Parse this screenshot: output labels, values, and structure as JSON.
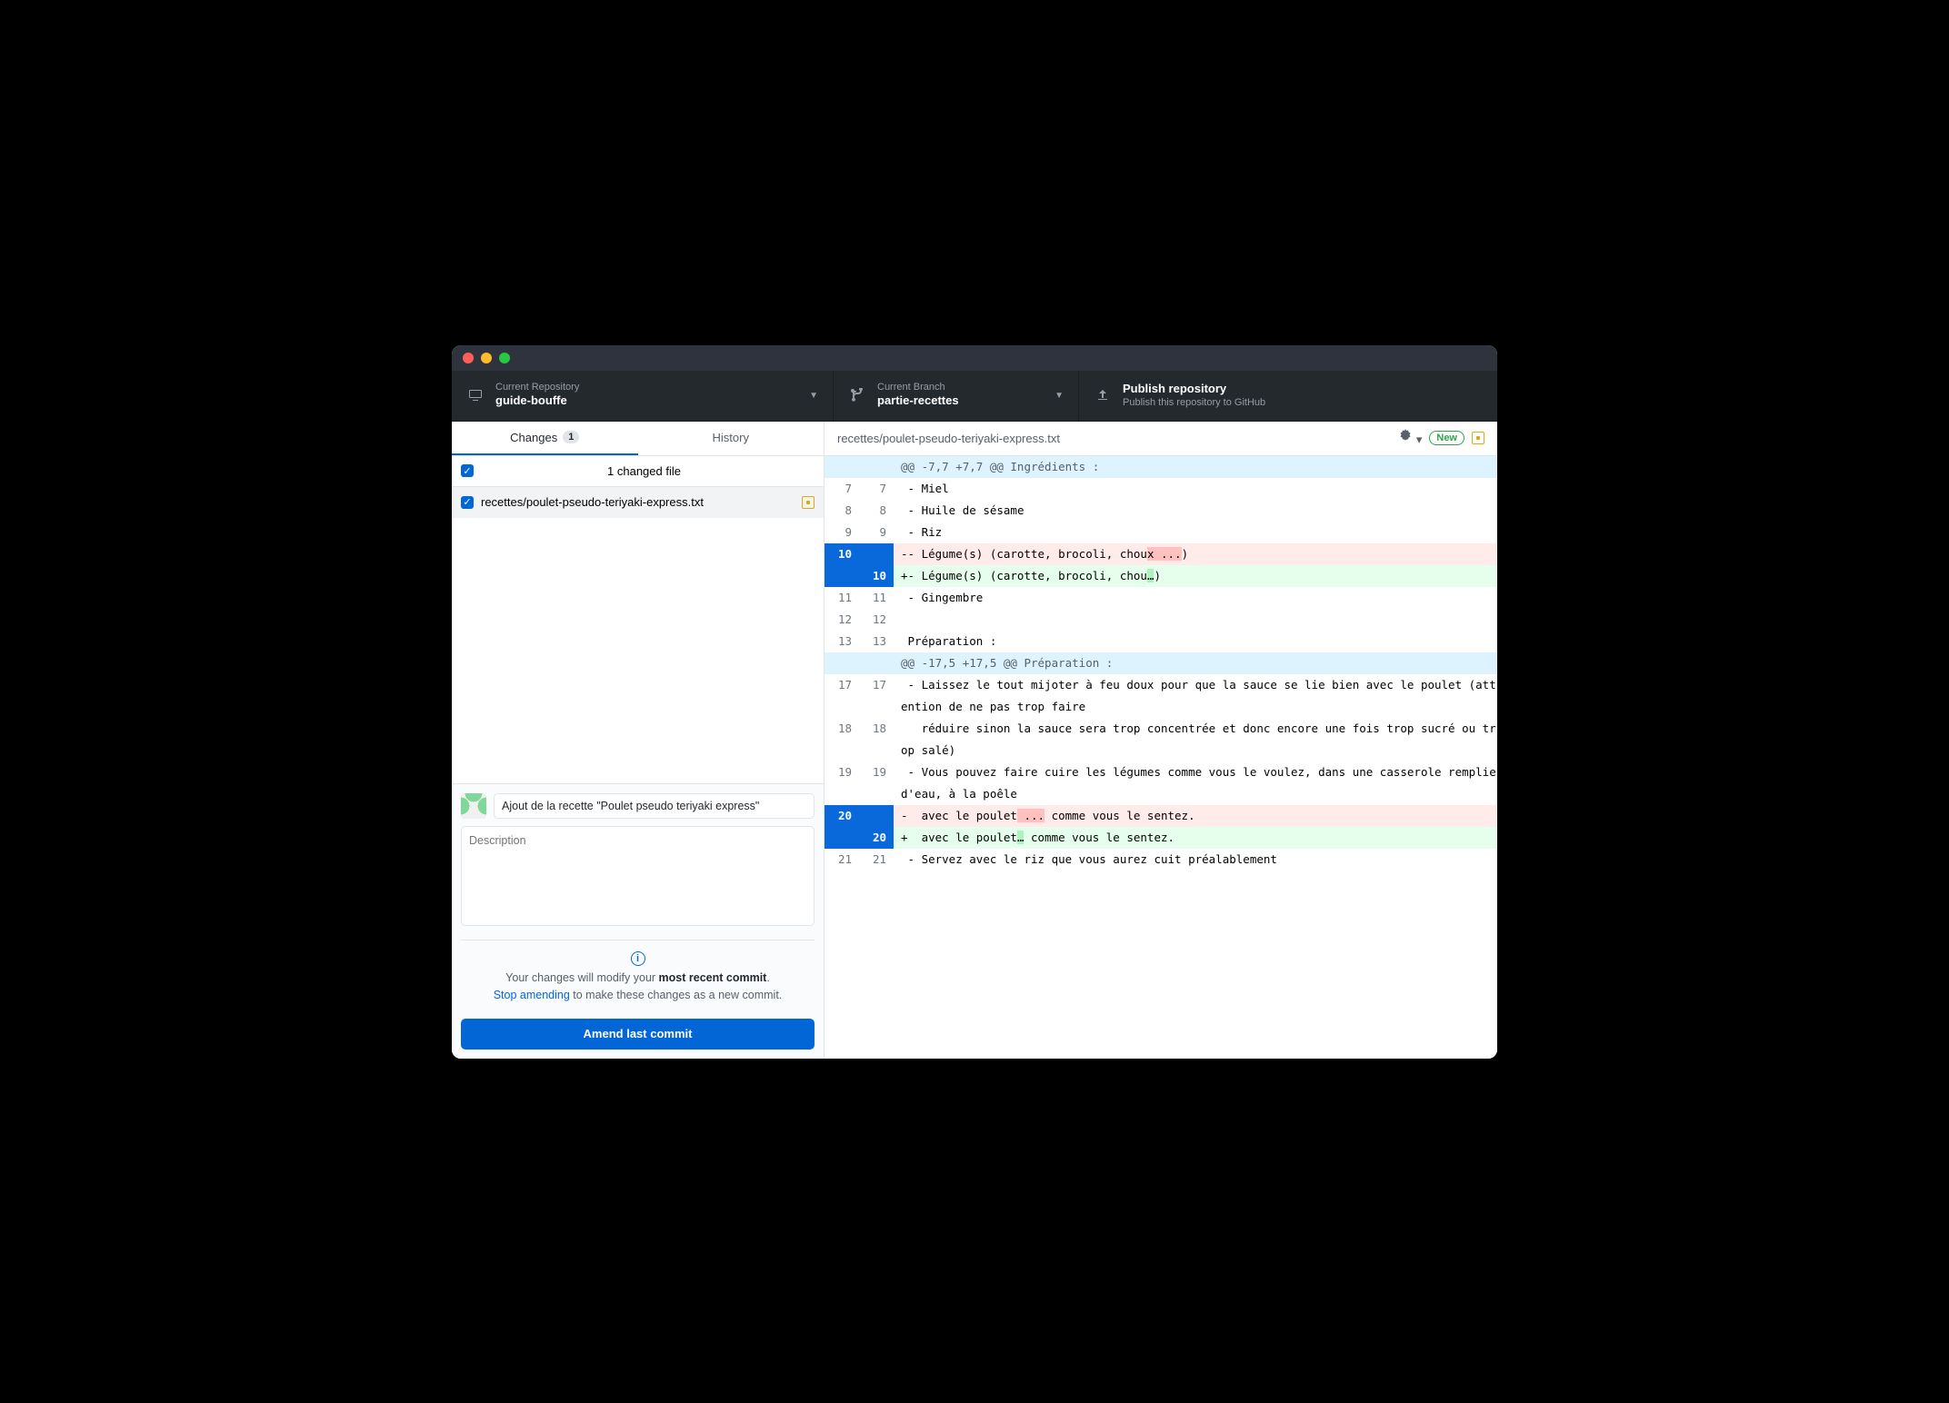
{
  "toolbar": {
    "repo": {
      "label": "Current Repository",
      "value": "guide-bouffe"
    },
    "branch": {
      "label": "Current Branch",
      "value": "partie-recettes"
    },
    "publish": {
      "label": "Publish repository",
      "value": "Publish this repository to GitHub"
    }
  },
  "tabs": {
    "changes": "Changes",
    "changes_count": "1",
    "history": "History"
  },
  "changes": {
    "header": "1 changed file",
    "file": "recettes/poulet-pseudo-teriyaki-express.txt"
  },
  "commit": {
    "summary": "Ajout de la recette \"Poulet pseudo teriyaki express\"",
    "description_placeholder": "Description",
    "info_pre": "Your changes will modify your ",
    "info_bold": "most recent commit",
    "info_post": ".",
    "stop_link": "Stop amending",
    "stop_post": " to make these changes as a new commit.",
    "button": "Amend last commit"
  },
  "diff": {
    "path": "recettes/poulet-pseudo-teriyaki-express.txt",
    "new_badge": "New",
    "lines": [
      {
        "t": "hunk",
        "o": "",
        "n": "",
        "c": "@@ -7,7 +7,7 @@ Ingrédients :"
      },
      {
        "t": "ctx",
        "o": "7",
        "n": "7",
        "c": " - Miel"
      },
      {
        "t": "ctx",
        "o": "8",
        "n": "8",
        "c": " - Huile de sésame"
      },
      {
        "t": "ctx",
        "o": "9",
        "n": "9",
        "c": " - Riz"
      },
      {
        "t": "del",
        "o": "10",
        "n": "",
        "c": "-- Légume(s) (carotte, brocoli, chou",
        "hl": "x ...",
        "tail": ")",
        "sel": true
      },
      {
        "t": "add",
        "o": "",
        "n": "10",
        "c": "+- Légume(s) (carotte, brocoli, chou",
        "hl": "…",
        "tail": ")",
        "sel": true
      },
      {
        "t": "ctx",
        "o": "11",
        "n": "11",
        "c": " - Gingembre"
      },
      {
        "t": "ctx",
        "o": "12",
        "n": "12",
        "c": " "
      },
      {
        "t": "ctx",
        "o": "13",
        "n": "13",
        "c": " Préparation :"
      },
      {
        "t": "hunk",
        "o": "",
        "n": "",
        "c": "@@ -17,5 +17,5 @@ Préparation :"
      },
      {
        "t": "ctx",
        "o": "17",
        "n": "17",
        "c": " - Laissez le tout mijoter à feu doux pour que la sauce se lie bien avec le poulet (attention de ne pas trop faire"
      },
      {
        "t": "ctx",
        "o": "18",
        "n": "18",
        "c": "   réduire sinon la sauce sera trop concentrée et donc encore une fois trop sucré ou trop salé)"
      },
      {
        "t": "ctx",
        "o": "19",
        "n": "19",
        "c": " - Vous pouvez faire cuire les légumes comme vous le voulez, dans une casserole remplie d'eau, à la poêle"
      },
      {
        "t": "del",
        "o": "20",
        "n": "",
        "c": "-  avec le poulet",
        "hl": " ...",
        "tail": " comme vous le sentez.",
        "sel": true
      },
      {
        "t": "add",
        "o": "",
        "n": "20",
        "c": "+  avec le poulet",
        "hl": "…",
        "tail": " comme vous le sentez.",
        "sel": true
      },
      {
        "t": "ctx",
        "o": "21",
        "n": "21",
        "c": " - Servez avec le riz que vous aurez cuit préalablement"
      }
    ]
  }
}
